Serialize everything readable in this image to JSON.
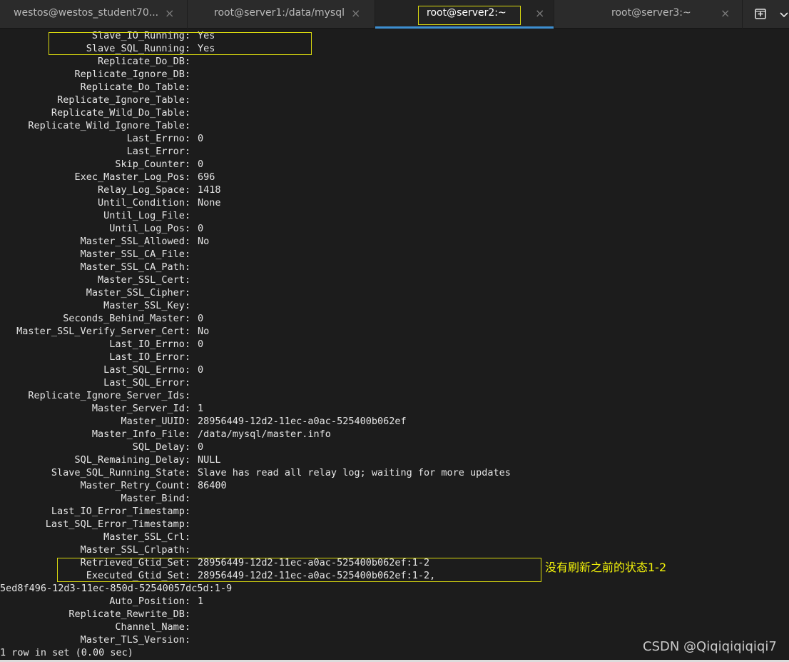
{
  "tabs": [
    {
      "label": "westos@westos_student70...",
      "close": "×",
      "active": false
    },
    {
      "label": "root@server1:/data/mysql",
      "close": "×",
      "active": false
    },
    {
      "label": "root@server2:~",
      "close": "×",
      "active": true
    },
    {
      "label": "root@server3:~",
      "close": "×",
      "active": false
    }
  ],
  "toolbar": {
    "new_tab_icon": "new-terminal-icon",
    "menu_icon": "chevron-down-icon"
  },
  "terminal": {
    "lines": [
      {
        "key": "Slave_IO_Running:",
        "value": "Yes"
      },
      {
        "key": "Slave_SQL_Running:",
        "value": "Yes"
      },
      {
        "key": "Replicate_Do_DB:",
        "value": ""
      },
      {
        "key": "Replicate_Ignore_DB:",
        "value": ""
      },
      {
        "key": "Replicate_Do_Table:",
        "value": ""
      },
      {
        "key": "Replicate_Ignore_Table:",
        "value": ""
      },
      {
        "key": "Replicate_Wild_Do_Table:",
        "value": ""
      },
      {
        "key": "Replicate_Wild_Ignore_Table:",
        "value": ""
      },
      {
        "key": "Last_Errno:",
        "value": "0"
      },
      {
        "key": "Last_Error:",
        "value": ""
      },
      {
        "key": "Skip_Counter:",
        "value": "0"
      },
      {
        "key": "Exec_Master_Log_Pos:",
        "value": "696"
      },
      {
        "key": "Relay_Log_Space:",
        "value": "1418"
      },
      {
        "key": "Until_Condition:",
        "value": "None"
      },
      {
        "key": "Until_Log_File:",
        "value": ""
      },
      {
        "key": "Until_Log_Pos:",
        "value": "0"
      },
      {
        "key": "Master_SSL_Allowed:",
        "value": "No"
      },
      {
        "key": "Master_SSL_CA_File:",
        "value": ""
      },
      {
        "key": "Master_SSL_CA_Path:",
        "value": ""
      },
      {
        "key": "Master_SSL_Cert:",
        "value": ""
      },
      {
        "key": "Master_SSL_Cipher:",
        "value": ""
      },
      {
        "key": "Master_SSL_Key:",
        "value": ""
      },
      {
        "key": "Seconds_Behind_Master:",
        "value": "0"
      },
      {
        "key": "Master_SSL_Verify_Server_Cert:",
        "value": "No"
      },
      {
        "key": "Last_IO_Errno:",
        "value": "0"
      },
      {
        "key": "Last_IO_Error:",
        "value": ""
      },
      {
        "key": "Last_SQL_Errno:",
        "value": "0"
      },
      {
        "key": "Last_SQL_Error:",
        "value": ""
      },
      {
        "key": "Replicate_Ignore_Server_Ids:",
        "value": ""
      },
      {
        "key": "Master_Server_Id:",
        "value": "1"
      },
      {
        "key": "Master_UUID:",
        "value": "28956449-12d2-11ec-a0ac-525400b062ef"
      },
      {
        "key": "Master_Info_File:",
        "value": "/data/mysql/master.info"
      },
      {
        "key": "SQL_Delay:",
        "value": "0"
      },
      {
        "key": "SQL_Remaining_Delay:",
        "value": "NULL"
      },
      {
        "key": "Slave_SQL_Running_State:",
        "value": "Slave has read all relay log; waiting for more updates"
      },
      {
        "key": "Master_Retry_Count:",
        "value": "86400"
      },
      {
        "key": "Master_Bind:",
        "value": ""
      },
      {
        "key": "Last_IO_Error_Timestamp:",
        "value": ""
      },
      {
        "key": "Last_SQL_Error_Timestamp:",
        "value": ""
      },
      {
        "key": "Master_SSL_Crl:",
        "value": ""
      },
      {
        "key": "Master_SSL_Crlpath:",
        "value": ""
      },
      {
        "key": "Retrieved_Gtid_Set:",
        "value": "28956449-12d2-11ec-a0ac-525400b062ef:1-2"
      },
      {
        "key": "Executed_Gtid_Set:",
        "value": "28956449-12d2-11ec-a0ac-525400b062ef:1-2,"
      },
      {
        "key": "",
        "value": "5ed8f496-12d3-11ec-850d-52540057dc5d:1-9"
      },
      {
        "key": "Auto_Position:",
        "value": "1"
      },
      {
        "key": "Replicate_Rewrite_DB:",
        "value": ""
      },
      {
        "key": "Channel_Name:",
        "value": ""
      },
      {
        "key": "Master_TLS_Version:",
        "value": ""
      },
      {
        "key": "",
        "value": "1 row in set (0.00 sec)"
      }
    ]
  },
  "annotation": "没有刷新之前的状态1-2",
  "watermark": "CSDN @Qiqiqiqiqiqi7",
  "colors": {
    "terminal_bg": "#1c1c1c",
    "terminal_fg": "#e6e6e6",
    "highlight": "#d8d80f",
    "annotation": "#f2f20a",
    "active_tab_underline": "#3d8fd1"
  }
}
